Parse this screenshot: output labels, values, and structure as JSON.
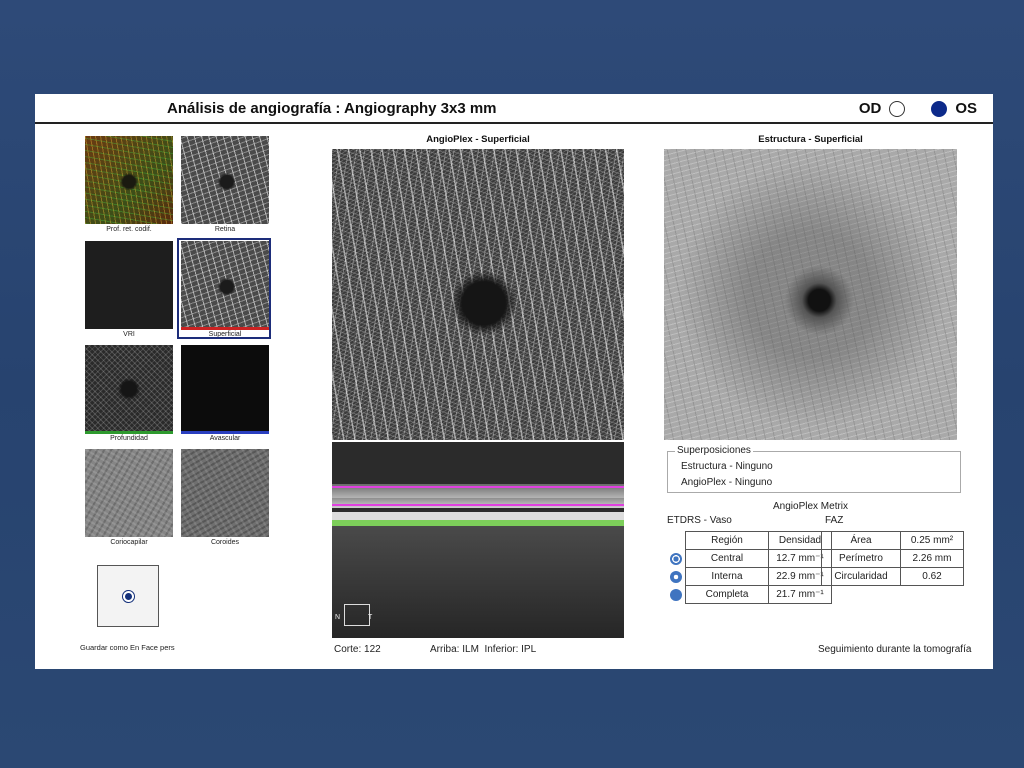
{
  "header": {
    "title": "Análisis de angiografía : Angiography 3x3 mm",
    "od_label": "OD",
    "os_label": "OS",
    "selected_eye": "OS"
  },
  "thumbnails": [
    {
      "name": "thumb-color-depth",
      "label": "Prof. ret. codif."
    },
    {
      "name": "thumb-retina",
      "label": "Retina"
    },
    {
      "name": "thumb-vri",
      "label": "VRI"
    },
    {
      "name": "thumb-superficial",
      "label": "Superficial",
      "selected": true
    },
    {
      "name": "thumb-deep",
      "label": "Profundidad"
    },
    {
      "name": "thumb-avascular",
      "label": "Avascular"
    },
    {
      "name": "thumb-choriocapillaris",
      "label": "Coriocapilar"
    },
    {
      "name": "thumb-choroid",
      "label": "Coroides"
    }
  ],
  "save_label": "Guardar como En Face pers",
  "angio": {
    "title": "AngioPlex - Superficial"
  },
  "structure": {
    "title": "Estructura - Superficial"
  },
  "bscan": {
    "nasal": "N",
    "temporal": "T"
  },
  "overlays": {
    "title": "Superposiciones",
    "structure": "Estructura - Ninguno",
    "angioplex": "AngioPlex - Ninguno"
  },
  "metrix": {
    "title": "AngioPlex Metrix",
    "etdrs_title": "ETDRS - Vaso",
    "faz_title": "FAZ",
    "etdrs_headers": [
      "Región",
      "Densidad"
    ],
    "etdrs_rows": [
      {
        "region": "Central",
        "density": "12.7 mm⁻¹"
      },
      {
        "region": "Interna",
        "density": "22.9 mm⁻¹"
      },
      {
        "region": "Completa",
        "density": "21.7 mm⁻¹"
      }
    ],
    "faz_rows": [
      {
        "label": "Área",
        "value": "0.25 mm²"
      },
      {
        "label": "Perímetro",
        "value": "2.26 mm"
      },
      {
        "label": "Circularidad",
        "value": "0.62"
      }
    ]
  },
  "footer": {
    "slice": "Corte: 122",
    "layers": "Arriba: ILM  Inferior: IPL",
    "tracking": "Seguimiento durante la tomografía"
  },
  "colors": {
    "background": "#2b4873",
    "selected_eye": "#0d2a8a",
    "selection_border": "#1d2d7a",
    "superficial_bar": "#cc2222",
    "deep_bar": "#2e9a2e",
    "avascular_bar": "#2a3fbf"
  }
}
